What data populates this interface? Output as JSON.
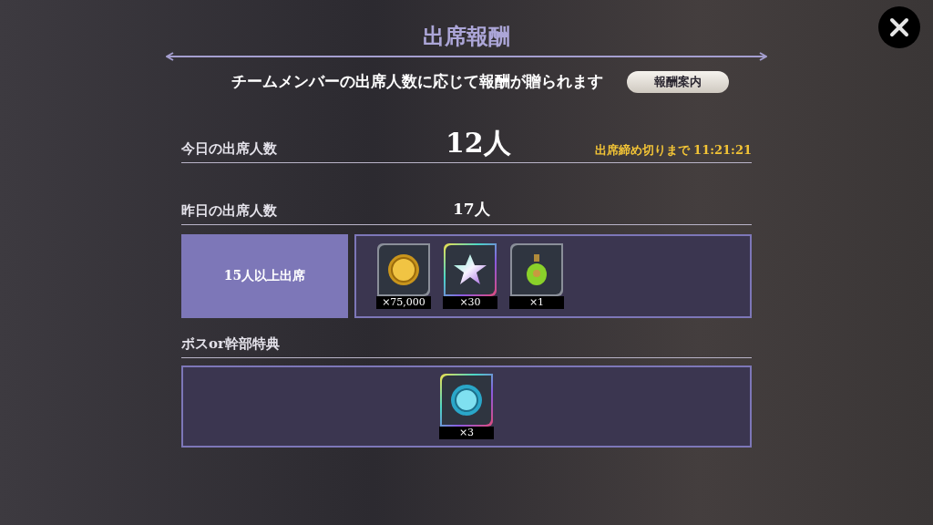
{
  "title": "出席報酬",
  "description": "チームメンバーの出席人数に応じて報酬が贈られます",
  "guide_button": "報酬案内",
  "today": {
    "label": "今日の出席人数",
    "count": "12人",
    "deadline": "出席締め切りまで 11:21:21"
  },
  "yesterday": {
    "label": "昨日の出席人数",
    "count": "17人"
  },
  "tiers": [
    {
      "label": "15人以上出席",
      "rewards": [
        {
          "kind": "coin",
          "rare": false,
          "quantity": "×75,000"
        },
        {
          "kind": "star",
          "rare": true,
          "quantity": "×30"
        },
        {
          "kind": "potion",
          "rare": false,
          "quantity": "×1"
        }
      ]
    }
  ],
  "boss_bonus": {
    "label": "ボスor幹部特典",
    "rewards": [
      {
        "kind": "token",
        "rare": true,
        "quantity": "×3"
      }
    ]
  }
}
